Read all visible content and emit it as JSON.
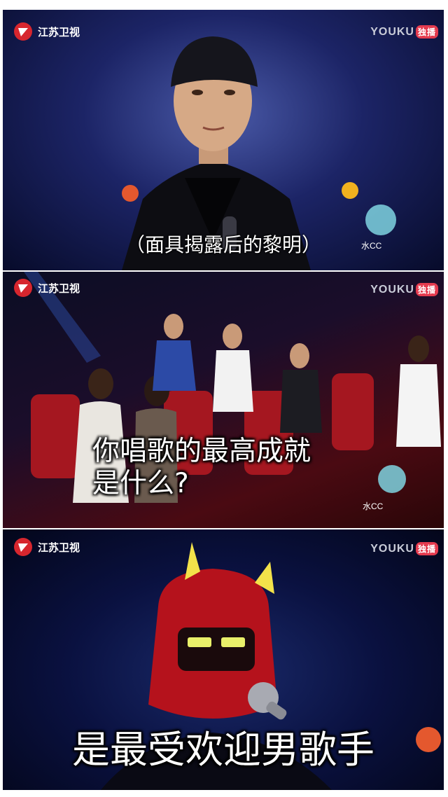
{
  "broadcaster": {
    "logo_text": "江苏卫视"
  },
  "streamer": {
    "name": "YOUKU",
    "badge": "独播"
  },
  "sponsor": {
    "label": "水CC"
  },
  "panels": [
    {
      "subtitle": "（面具揭露后的黎明）"
    },
    {
      "subtitle_line1": "你唱歌的最高成就",
      "subtitle_line2": "是什么?"
    },
    {
      "subtitle": "是最受欢迎男歌手"
    }
  ]
}
